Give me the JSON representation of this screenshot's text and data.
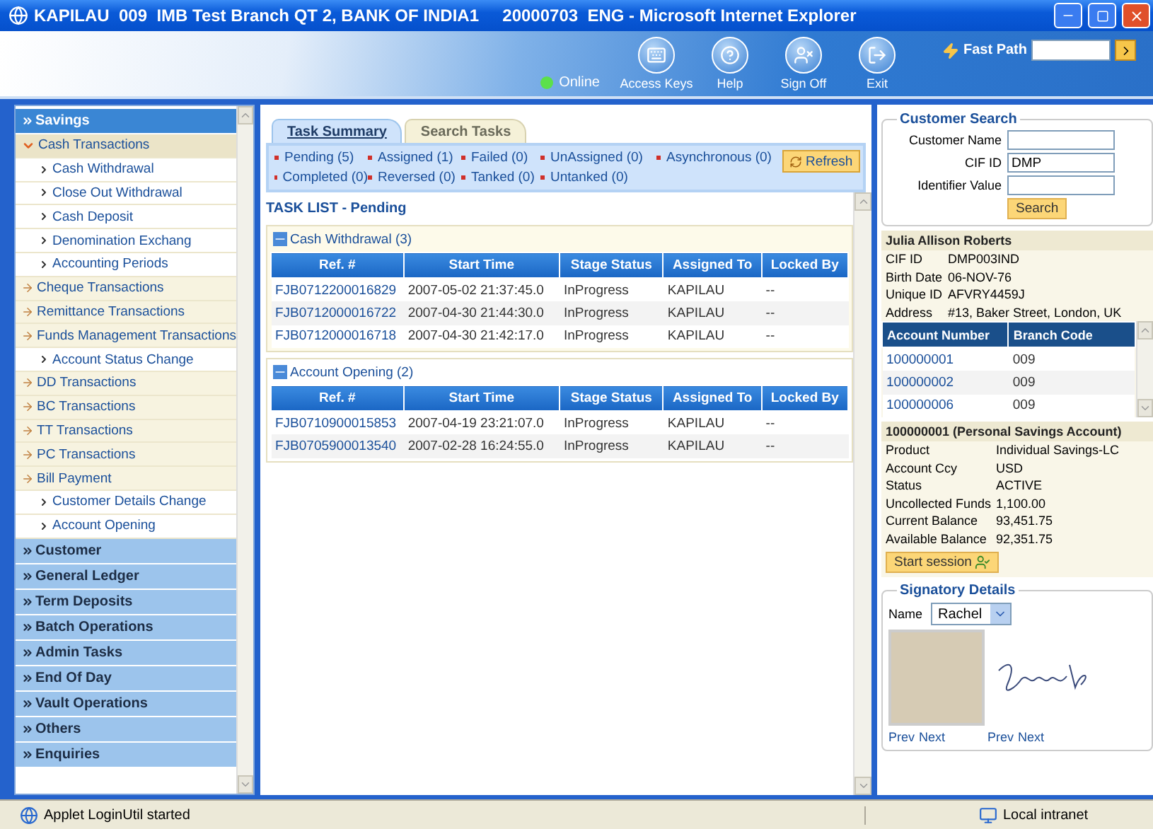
{
  "window": {
    "title": "KAPILAU  009  IMB Test Branch QT 2, BANK OF INDIA1     20000703  ENG - Microsoft Internet Explorer"
  },
  "header": {
    "status": "Online",
    "actions": [
      {
        "label": "Access Keys",
        "kind": "keys"
      },
      {
        "label": "Help",
        "kind": "help"
      },
      {
        "label": "Sign Off",
        "kind": "signoff"
      },
      {
        "label": "Exit",
        "kind": "exit"
      }
    ],
    "fast_path": {
      "label": "Fast Path"
    }
  },
  "sidebar": {
    "sections": [
      {
        "label": "Savings",
        "expanded": true,
        "items": [
          {
            "label": "Cash Transactions",
            "kind": "group",
            "expanded": true,
            "children": [
              {
                "label": "Cash Withdrawal",
                "kind": "link"
              },
              {
                "label": "Close Out Withdrawal",
                "kind": "link"
              },
              {
                "label": "Cash Deposit",
                "kind": "link"
              },
              {
                "label": "Denomination Exchang",
                "kind": "link"
              },
              {
                "label": "Accounting Periods",
                "kind": "link"
              }
            ]
          },
          {
            "label": "Cheque Transactions",
            "kind": "group",
            "expanded": false
          },
          {
            "label": "Remittance Transactions",
            "kind": "group",
            "expanded": false
          },
          {
            "label": "Funds Management Transactions",
            "kind": "group",
            "expanded": false
          },
          {
            "label": "Account Status Change",
            "kind": "link"
          },
          {
            "label": "DD Transactions",
            "kind": "group",
            "expanded": false
          },
          {
            "label": "BC Transactions",
            "kind": "group",
            "expanded": false
          },
          {
            "label": "TT Transactions",
            "kind": "group",
            "expanded": false
          },
          {
            "label": "PC Transactions",
            "kind": "group",
            "expanded": false
          },
          {
            "label": "Bill Payment",
            "kind": "group",
            "expanded": false
          },
          {
            "label": "Customer Details Change",
            "kind": "link"
          },
          {
            "label": "Account Opening",
            "kind": "link"
          }
        ]
      },
      {
        "label": "Customer",
        "expanded": false
      },
      {
        "label": "General Ledger",
        "expanded": false
      },
      {
        "label": "Term Deposits",
        "expanded": false
      },
      {
        "label": "Batch Operations",
        "expanded": false
      },
      {
        "label": "Admin Tasks",
        "expanded": false
      },
      {
        "label": "End Of Day",
        "expanded": false
      },
      {
        "label": "Vault Operations",
        "expanded": false
      },
      {
        "label": "Others",
        "expanded": false
      },
      {
        "label": "Enquiries",
        "expanded": false
      }
    ]
  },
  "tabs": [
    {
      "label": "Task Summary",
      "selected": true
    },
    {
      "label": "Search Tasks",
      "selected": false
    }
  ],
  "filters": [
    "Pending (5)",
    "Assigned (1)",
    "Failed (0)",
    "UnAssigned (0)",
    "Asynchronous (0)",
    "Completed (0)",
    "Reversed (0)",
    "Tanked (0)",
    "Untanked (0)"
  ],
  "refresh_button": "Refresh",
  "task_list": {
    "title": "TASK LIST - Pending",
    "groups": [
      {
        "title": "Cash Withdrawal (3)",
        "expanded": true,
        "columns": [
          "Ref. #",
          "Start Time",
          "Stage Status",
          "Assigned To",
          "Locked By"
        ],
        "rows": [
          [
            "FJB0712200016829",
            "2007-05-02 21:37:45.0",
            "InProgress",
            "KAPILAU",
            "--"
          ],
          [
            "FJB0712000016722",
            "2007-04-30 21:44:30.0",
            "InProgress",
            "KAPILAU",
            "--"
          ],
          [
            "FJB0712000016718",
            "2007-04-30 21:42:17.0",
            "InProgress",
            "KAPILAU",
            "--"
          ]
        ]
      },
      {
        "title": "Account Opening (2)",
        "expanded": true,
        "columns": [
          "Ref. #",
          "Start Time",
          "Stage Status",
          "Assigned To",
          "Locked By"
        ],
        "rows": [
          [
            "FJB0710900015853",
            "2007-04-19 23:21:07.0",
            "InProgress",
            "KAPILAU",
            "--"
          ],
          [
            "FJB0705900013540",
            "2007-02-28 16:24:55.0",
            "InProgress",
            "KAPILAU",
            "--"
          ]
        ]
      }
    ]
  },
  "customer_search": {
    "title": "Customer Search",
    "fields": [
      {
        "label": "Customer Name"
      },
      {
        "label": "CIF ID",
        "value": "DMP"
      },
      {
        "label": "Identifier Value"
      }
    ],
    "button": "Search"
  },
  "customer": {
    "name": "Julia Allison Roberts",
    "details": [
      {
        "label": "CIF ID",
        "value": "DMP003IND"
      },
      {
        "label": "Birth Date",
        "value": "06-NOV-76"
      },
      {
        "label": "Unique ID",
        "value": "AFVRY4459J"
      },
      {
        "label": "Address",
        "value": "#13, Baker Street, London, UK"
      }
    ],
    "accounts": {
      "columns": [
        "Account Number",
        "Branch Code"
      ],
      "rows": [
        [
          "100000001",
          "009"
        ],
        [
          "100000002",
          "009"
        ],
        [
          "100000006",
          "009"
        ]
      ]
    }
  },
  "account": {
    "title": "100000001 (Personal Savings Account)",
    "details": [
      {
        "label": "Product",
        "value": "Individual Savings-LC"
      },
      {
        "label": "Account Ccy",
        "value": "USD"
      },
      {
        "label": "Status",
        "value": "ACTIVE"
      },
      {
        "label": "Uncollected Funds",
        "value": "1,100.00"
      },
      {
        "label": "Current Balance",
        "value": "93,451.75"
      },
      {
        "label": "Available Balance",
        "value": "92,351.75"
      }
    ],
    "button": "Start session"
  },
  "signatory": {
    "title": "Signatory Details",
    "name_label": "Name",
    "name_value": "Rachel",
    "photo_nav": [
      "Prev",
      "Next"
    ],
    "signature_nav": [
      "Prev",
      "Next"
    ]
  },
  "status_bar": {
    "message": "Applet LoginUtil started",
    "zone": "Local intranet"
  }
}
